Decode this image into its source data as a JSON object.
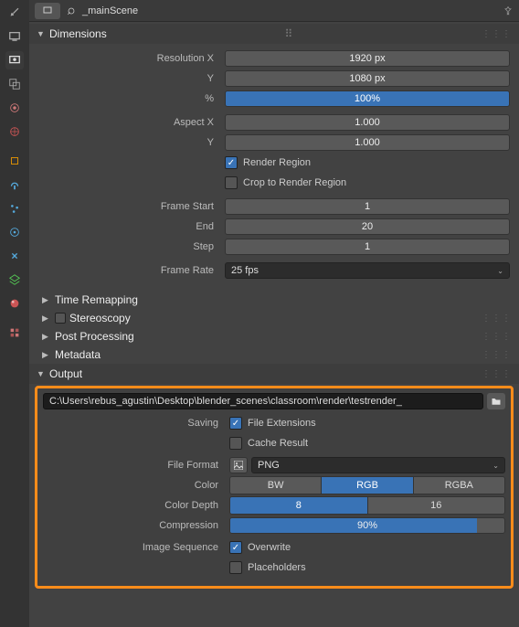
{
  "header": {
    "scene_name": "_mainScene"
  },
  "panels": {
    "dimensions": {
      "title": "Dimensions",
      "resolution_x_label": "Resolution X",
      "resolution_x": "1920 px",
      "resolution_y_label": "Y",
      "resolution_y": "1080 px",
      "percent_label": "%",
      "percent": "100%",
      "aspect_x_label": "Aspect X",
      "aspect_x": "1.000",
      "aspect_y_label": "Y",
      "aspect_y": "1.000",
      "render_region_label": "Render Region",
      "crop_region_label": "Crop to Render Region",
      "frame_start_label": "Frame Start",
      "frame_start": "1",
      "frame_end_label": "End",
      "frame_end": "20",
      "frame_step_label": "Step",
      "frame_step": "1",
      "frame_rate_label": "Frame Rate",
      "frame_rate": "25 fps"
    },
    "time_remapping": "Time Remapping",
    "stereoscopy": "Stereoscopy",
    "post_processing": "Post Processing",
    "metadata": "Metadata",
    "output": {
      "title": "Output",
      "path": "C:\\Users\\rebus_agustin\\Desktop\\blender_scenes\\classroom\\render\\testrender_",
      "saving_label": "Saving",
      "file_extensions_label": "File Extensions",
      "cache_result_label": "Cache Result",
      "file_format_label": "File Format",
      "file_format": "PNG",
      "color_label": "Color",
      "color_bw": "BW",
      "color_rgb": "RGB",
      "color_rgba": "RGBA",
      "color_depth_label": "Color Depth",
      "depth_8": "8",
      "depth_16": "16",
      "compression_label": "Compression",
      "compression": "90%",
      "image_sequence_label": "Image Sequence",
      "overwrite_label": "Overwrite",
      "placeholders_label": "Placeholders"
    }
  },
  "colors": {
    "accent": "#3973b6",
    "highlight_border": "#ff8c1a"
  }
}
